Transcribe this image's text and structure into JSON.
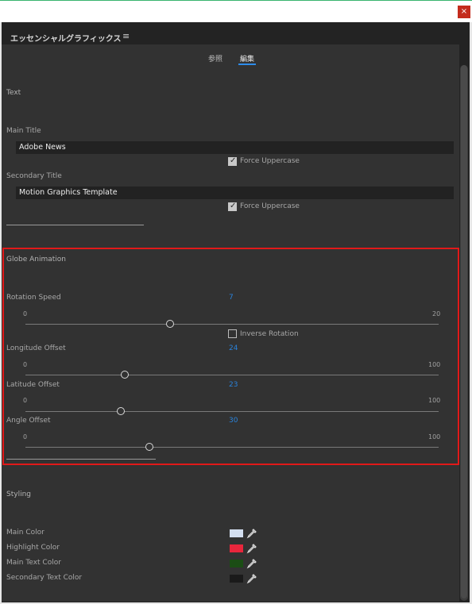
{
  "window": {
    "close_glyph": "×"
  },
  "panel": {
    "title": "エッセンシャルグラフィックス",
    "menu_glyph": "≡"
  },
  "tabs": [
    {
      "label": "参照",
      "active": false
    },
    {
      "label": "編集",
      "active": true
    }
  ],
  "text_section": {
    "title": "Text",
    "main_title": {
      "label": "Main Title",
      "value": "Adobe News",
      "checkbox_label": "Force Uppercase",
      "checked": true
    },
    "secondary_title": {
      "label": "Secondary Title",
      "value": "Motion Graphics Template",
      "checkbox_label": "Force Uppercase",
      "checked": true
    }
  },
  "globe_section": {
    "title": "Globe Animation",
    "rotation_speed": {
      "label": "Rotation Speed",
      "value": "7",
      "min": "0",
      "max": "20",
      "fraction": 0.35
    },
    "inverse_rotation": {
      "label": "Inverse Rotation",
      "checked": false
    },
    "longitude_offset": {
      "label": "Longitude Offset",
      "value": "24",
      "min": "0",
      "max": "100",
      "fraction": 0.24
    },
    "latitude_offset": {
      "label": "Latitude Offset",
      "value": "23",
      "min": "0",
      "max": "100",
      "fraction": 0.23
    },
    "angle_offset": {
      "label": "Angle Offset",
      "value": "30",
      "min": "0",
      "max": "100",
      "fraction": 0.3
    }
  },
  "styling_section": {
    "title": "Styling",
    "colors": [
      {
        "label": "Main Color",
        "hex": "#d3dff0"
      },
      {
        "label": "Highlight Color",
        "hex": "#e8263c"
      },
      {
        "label": "Main Text Color",
        "hex": "#1b4d15"
      },
      {
        "label": "Secondary Text Color",
        "hex": "#1a1a1a"
      }
    ],
    "eyedropper_icon": "eyedropper-icon"
  },
  "colors": {
    "accent": "#2a82d9",
    "highlight_border": "#e11919"
  }
}
